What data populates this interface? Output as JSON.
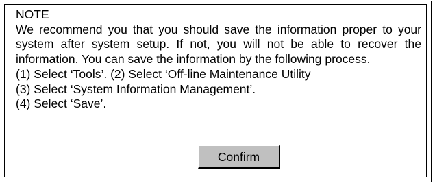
{
  "note": {
    "title": "NOTE",
    "body": "We recommend you that you should save the information proper to your system after system setup. If not, you will not be able to recover the information. You can save the information by the following process.",
    "steps": [
      "(1) Select ‘Tools’. (2) Select ‘Off-line Maintenance Utility",
      "(3) Select ‘System Information Management’.",
      "(4) Select ‘Save’."
    ]
  },
  "buttons": {
    "confirm_label": "Confirm"
  },
  "colors": {
    "button_face": "#c0c0c0",
    "border": "#000000",
    "background": "#ffffff"
  }
}
